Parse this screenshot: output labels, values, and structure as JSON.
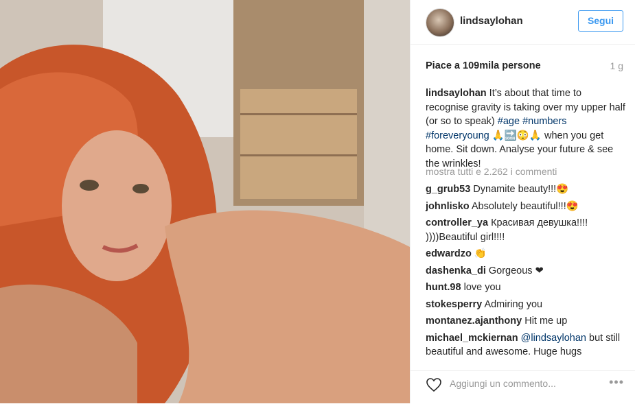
{
  "header": {
    "username": "lindsaylohan",
    "follow_label": "Segui"
  },
  "meta": {
    "likes": "Piace a 109mila persone",
    "time": "1 g"
  },
  "caption": {
    "user": "lindsaylohan",
    "text_1": " It’s about that time to recognise gravity is taking over my upper half (or so to speak) ",
    "tag_age": "#age",
    "tag_numbers": "#numbers",
    "tag_foreveryoung": "#foreveryoung",
    "emoji": " 🙏🔜😳🙏 ",
    "text_2": "when you get home. Sit down. Analyse your future & see the wrinkles!"
  },
  "more_comments": "mostra tutti e 2.262 i commenti",
  "comments": [
    {
      "user": "g_grub53",
      "text": " Dynamite beauty!!!😍"
    },
    {
      "user": "johnlisko",
      "text": " Absolutely beautiful!!!😍"
    },
    {
      "user": "controller_ya",
      "text": " Красивая девушка!!!! ))))Beautiful girl!!!!"
    },
    {
      "user": "edwardzo",
      "text": " 👏"
    },
    {
      "user": "dashenka_di",
      "text": " Gorgeous ❤"
    },
    {
      "user": "hunt.98",
      "text": " love you"
    },
    {
      "user": "stokesperry",
      "text": " Admiring you"
    },
    {
      "user": "montanez.ajanthony",
      "text": " Hit me up"
    }
  ],
  "last_comment": {
    "user": "michael_mckiernan",
    "mention": " @lindsaylohan",
    "text": " but still beautiful and awesome. Huge hugs"
  },
  "footer": {
    "placeholder": "Aggiungi un commento...",
    "more_icon": "•••"
  },
  "colors": {
    "accent": "#3897f0",
    "link": "#003569",
    "muted": "#999999"
  }
}
